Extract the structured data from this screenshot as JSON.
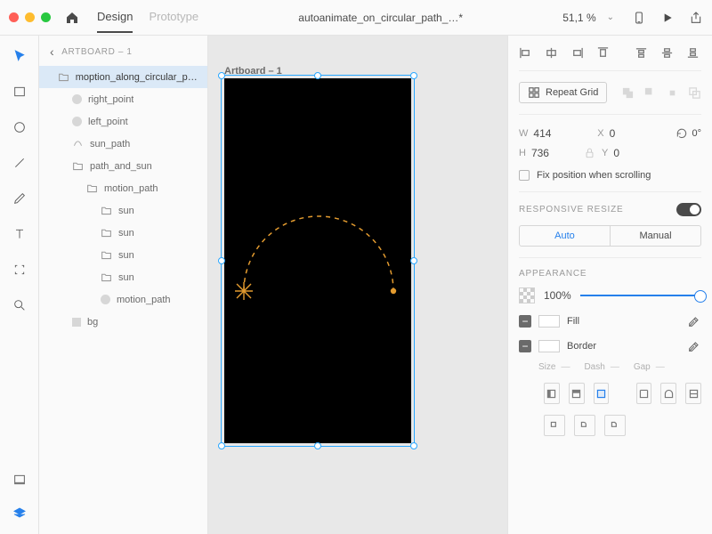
{
  "topbar": {
    "tabs": {
      "design": "Design",
      "prototype": "Prototype"
    },
    "title": "autoanimate_on_circular_path_…*",
    "zoom": "51,1 %"
  },
  "layers": {
    "head": "ARTBOARD – 1",
    "items": [
      {
        "label": "moption_along_circular_pa…",
        "type": "folder",
        "indent": 14,
        "selected": true
      },
      {
        "label": "right_point",
        "type": "dot",
        "indent": 30
      },
      {
        "label": "left_point",
        "type": "dot",
        "indent": 30
      },
      {
        "label": "sun_path",
        "type": "path",
        "indent": 30
      },
      {
        "label": "path_and_sun",
        "type": "folder",
        "indent": 30
      },
      {
        "label": "motion_path",
        "type": "folder",
        "indent": 46
      },
      {
        "label": "sun",
        "type": "folder",
        "indent": 62
      },
      {
        "label": "sun",
        "type": "folder",
        "indent": 62
      },
      {
        "label": "sun",
        "type": "folder",
        "indent": 62
      },
      {
        "label": "sun",
        "type": "folder",
        "indent": 62
      },
      {
        "label": "motion_path",
        "type": "dot",
        "indent": 62
      },
      {
        "label": "bg",
        "type": "square",
        "indent": 30
      }
    ]
  },
  "canvas": {
    "artboard_label": "Artboard – 1"
  },
  "inspector": {
    "repeat_grid": "Repeat Grid",
    "w": "414",
    "h": "736",
    "x": "0",
    "y": "0",
    "w_lbl": "W",
    "h_lbl": "H",
    "x_lbl": "X",
    "y_lbl": "Y",
    "rotation": "0°",
    "fix_label": "Fix position when scrolling",
    "responsive": "RESPONSIVE RESIZE",
    "auto": "Auto",
    "manual": "Manual",
    "appearance": "APPEARANCE",
    "opacity": "100%",
    "fill": "Fill",
    "border": "Border",
    "size": "Size",
    "dash": "Dash",
    "gap": "Gap",
    "dash_dash": "—"
  }
}
